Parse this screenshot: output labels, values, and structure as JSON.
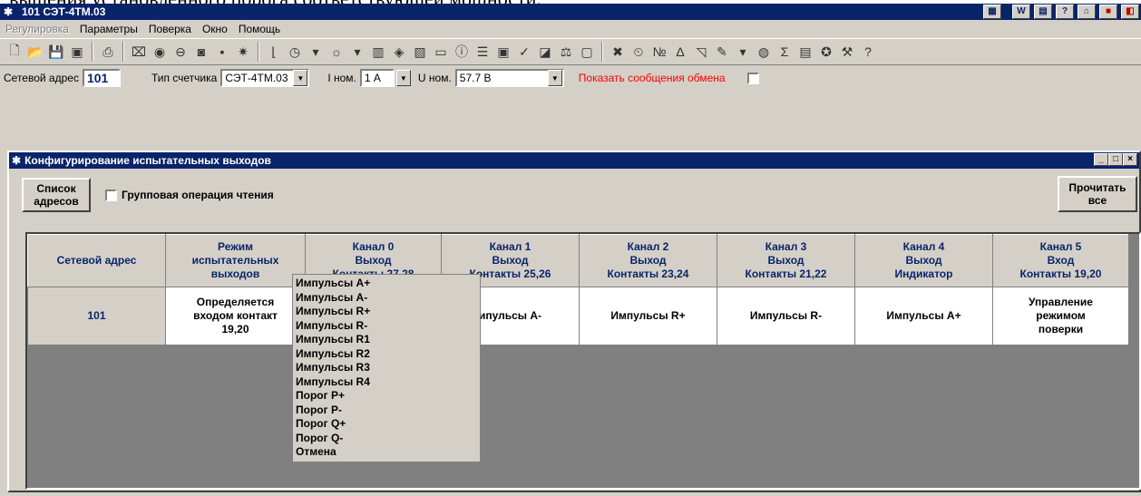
{
  "doc_fragment": "вышения установленного порога соответствующей мощности.",
  "app": {
    "title": "101  СЭТ-4ТМ.03",
    "title_icon": "asterisk-icon"
  },
  "menu": [
    "Регулировка",
    "Параметры",
    "Поверка",
    "Окно",
    "Помощь"
  ],
  "params": {
    "network_address_label": "Сетевой адрес",
    "network_address_value": "101",
    "meter_type_label": "Тип счетчика",
    "meter_type_value": "СЭТ-4ТМ.03",
    "i_nom_label": "I ном.",
    "i_nom_value": "1 А",
    "u_nom_label": "U ном.",
    "u_nom_value": "57.7 В",
    "show_messages_label": "Показать сообщения обмена"
  },
  "child_window": {
    "title": "Конфигурирование испытательных выходов",
    "address_list_button": [
      "Список",
      "адресов"
    ],
    "group_read_label": "Групповая операция чтения",
    "read_all_button": [
      "Прочитать",
      "все"
    ]
  },
  "table": {
    "headers": [
      [
        "Сетевой адрес"
      ],
      [
        "Режим",
        "испытательных",
        "выходов"
      ],
      [
        "Канал 0",
        "Выход",
        "Контакты 27,28"
      ],
      [
        "Канал 1",
        "Выход",
        "Контакты 25,26"
      ],
      [
        "Канал 2",
        "Выход",
        "Контакты 23,24"
      ],
      [
        "Канал 3",
        "Выход",
        "Контакты 21,22"
      ],
      [
        "Канал 4",
        "Выход",
        "Индикатор"
      ],
      [
        "Канал 5",
        "Вход",
        "Контакты 19,20"
      ]
    ],
    "row": {
      "address": "101",
      "mode": [
        "Определяется",
        "входом контакт",
        "19,20"
      ],
      "ch0": "",
      "ch1": "ипульсы А-",
      "ch2": "Импульсы R+",
      "ch3": "Импульсы R-",
      "ch4": "Импульсы А+",
      "ch5": [
        "Управление",
        "режимом",
        "поверки"
      ]
    }
  },
  "dropdown_options": [
    "Импульсы А+",
    "Импульсы А-",
    "Импульсы R+",
    "Импульсы R-",
    "Импульсы R1",
    "Импульсы R2",
    "Импульсы R3",
    "Импульсы R4",
    "Порог P+",
    "Порог P-",
    "Порог Q+",
    "Порог Q-",
    "Отмена"
  ],
  "colors": {
    "title_bar": "#0a246a",
    "face": "#d4d0c8",
    "header_text": "#0a246a",
    "alert_text": "#ff0000"
  }
}
